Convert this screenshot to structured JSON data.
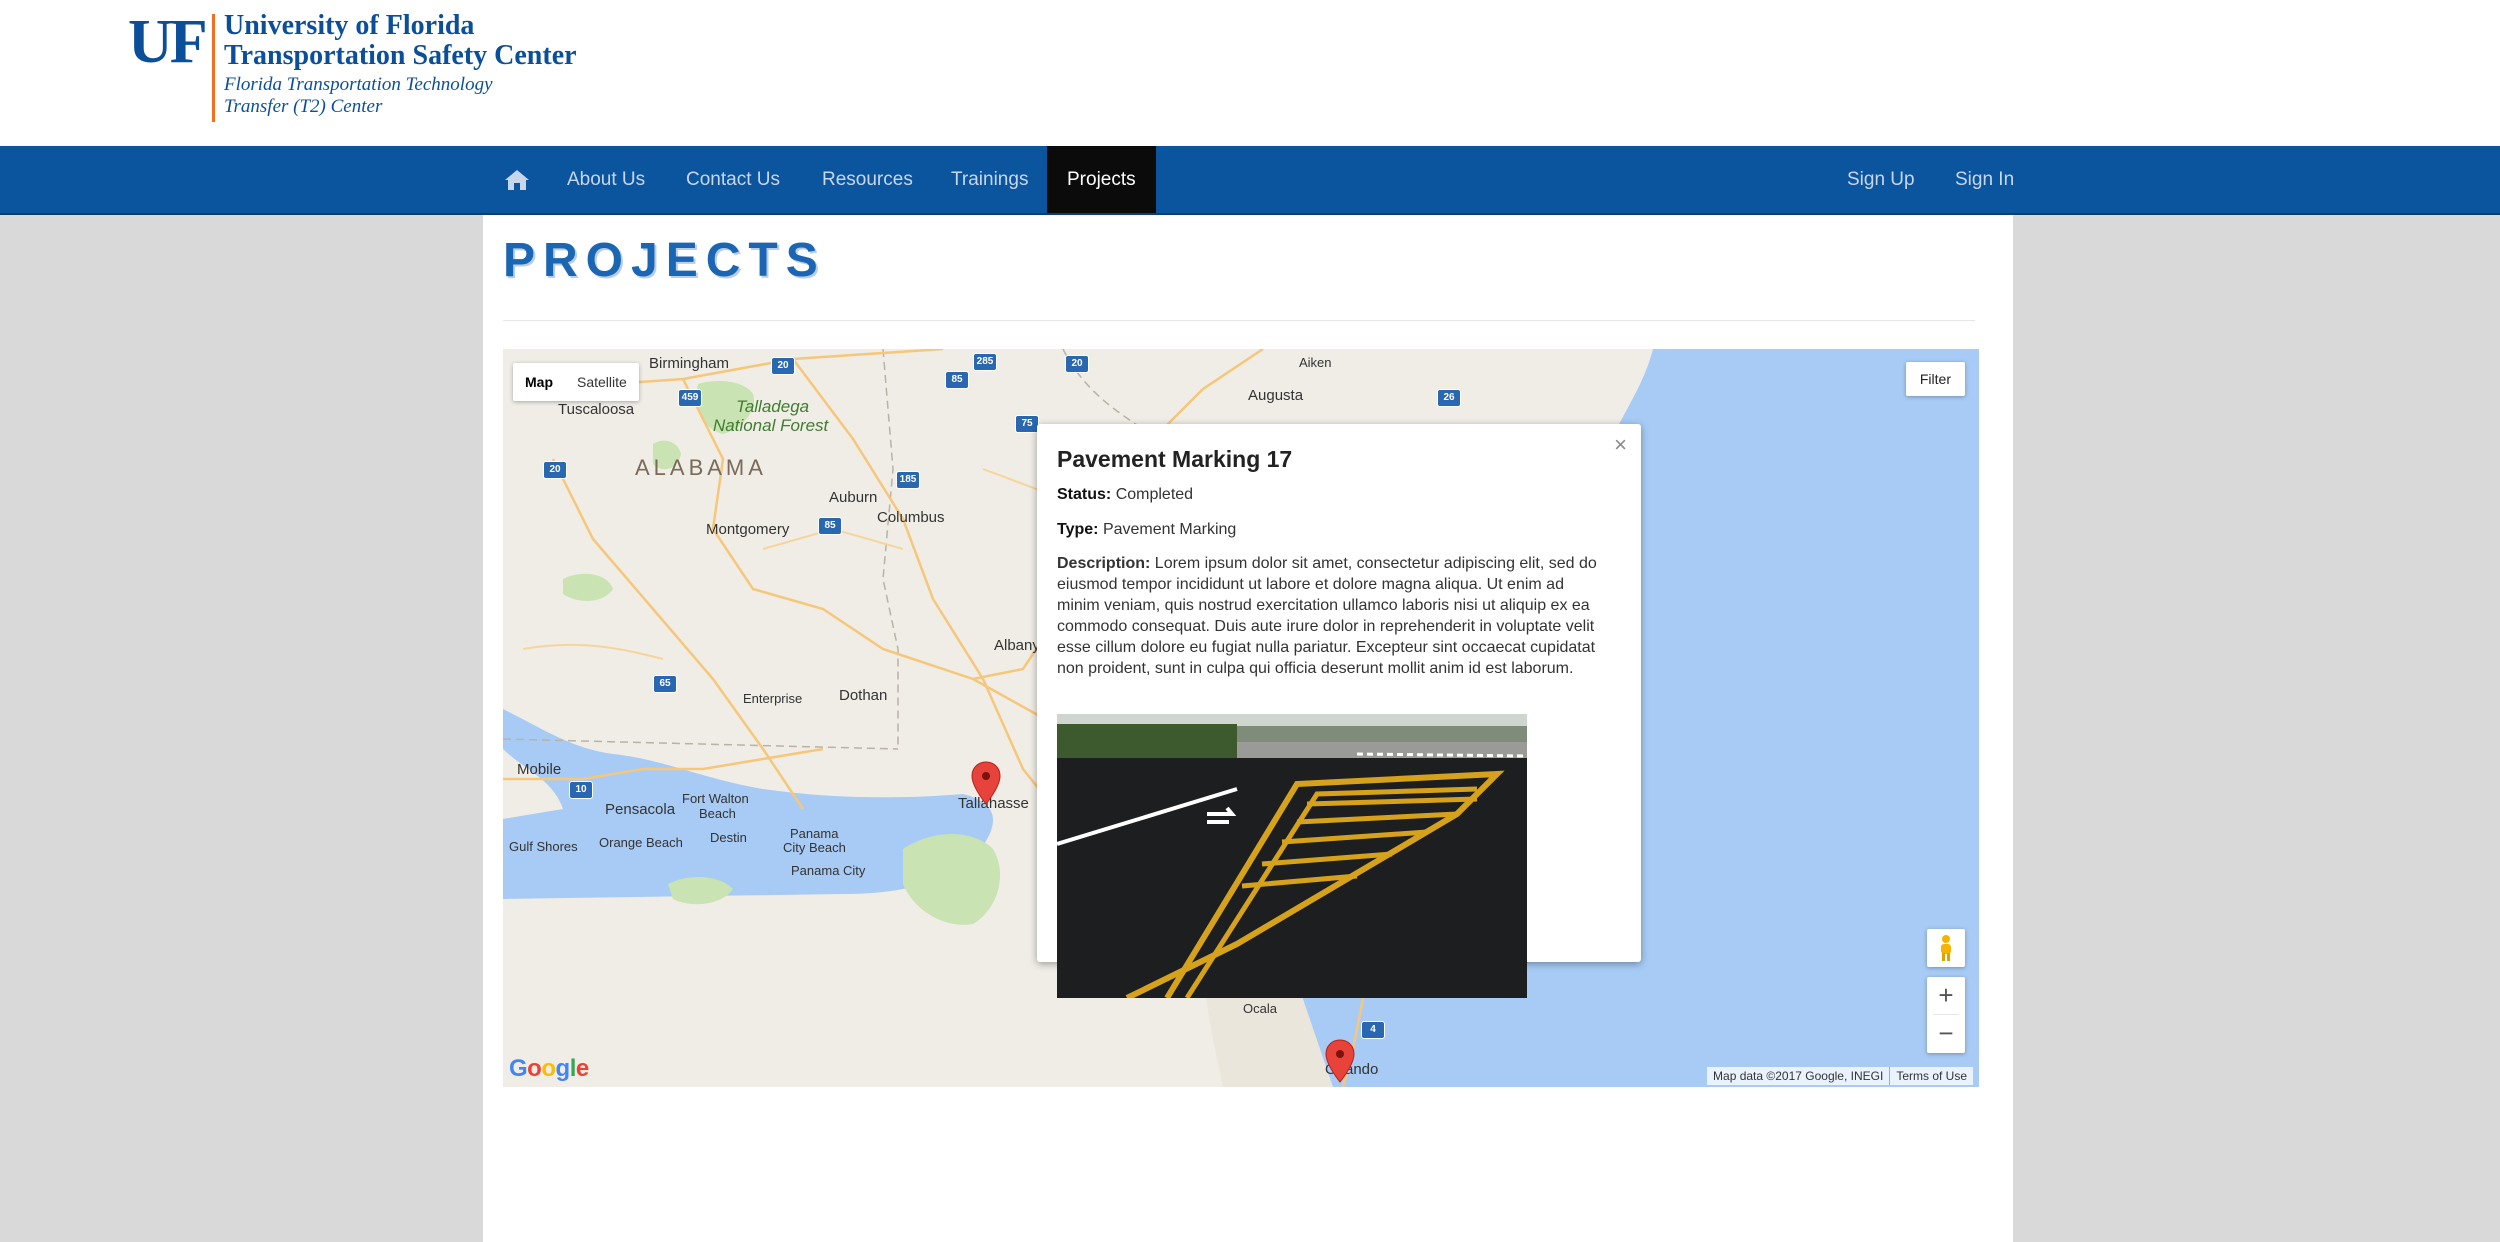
{
  "header": {
    "logo_mark": "UF",
    "logo_line1": "University of Florida",
    "logo_line2": "Transportation Safety Center",
    "logo_line3": "Florida Transportation Technology",
    "logo_line4": "Transfer (T2) Center"
  },
  "nav": {
    "items": [
      {
        "label": "About Us"
      },
      {
        "label": "Contact Us"
      },
      {
        "label": "Resources"
      },
      {
        "label": "Trainings"
      },
      {
        "label": "Projects"
      }
    ],
    "active": "Projects",
    "right": [
      {
        "label": "Sign Up"
      },
      {
        "label": "Sign In"
      }
    ]
  },
  "page": {
    "title": "PROJECTS"
  },
  "map": {
    "type_buttons": [
      "Map",
      "Satellite"
    ],
    "selected_type": "Map",
    "filter_label": "Filter",
    "zoom_in": "+",
    "zoom_out": "−",
    "google_logo": "Google",
    "attribution": "Map data ©2017 Google, INEGI",
    "terms": "Terms of Use",
    "labels": {
      "birmingham": "Birmingham",
      "tuscaloosa": "Tuscaloosa",
      "talladega": "Talladega",
      "national_forest": "National Forest",
      "alabama": "ALABAMA",
      "montgomery": "Montgomery",
      "auburn": "Auburn",
      "columbus": "Columbus",
      "augusta": "Augusta",
      "aiken": "Aiken",
      "albany": "Albany",
      "enterprise": "Enterprise",
      "dothan": "Dothan",
      "mobile": "Mobile",
      "pensacola": "Pensacola",
      "fort_walton": "Fort Walton",
      "beach": "Beach",
      "destin": "Destin",
      "panama": "Panama",
      "city_beach": "City Beach",
      "panama_city": "Panama City",
      "gulf_shores": "Gulf Shores",
      "orange_beach": "Orange Beach",
      "tallahassee": "Tallahasse",
      "ocala": "Ocala",
      "orlando": "Orlando"
    },
    "shields": [
      "459",
      "20",
      "85",
      "285",
      "20",
      "26",
      "75",
      "20",
      "185",
      "85",
      "65",
      "10",
      "4"
    ]
  },
  "infowindow": {
    "title": "Pavement Marking 17",
    "status_label": "Status:",
    "status_value": "Completed",
    "type_label": "Type:",
    "type_value": "Pavement Marking",
    "description_label": "Description:",
    "description_value": "Lorem ipsum dolor sit amet, consectetur adipiscing elit, sed do eiusmod tempor incididunt ut labore et dolore magna aliqua. Ut enim ad minim veniam, quis nostrud exercitation ullamco laboris nisi ut aliquip ex ea commodo consequat. Duis aute irure dolor in reprehenderit in voluptate velit esse cillum dolore eu fugiat nulla pariatur. Excepteur sint occaecat cupidatat non proident, sunt in culpa qui officia deserunt mollit anim id est laborum.",
    "close": "×"
  },
  "colors": {
    "brand_blue": "#0b559f",
    "nav_active": "#0b0b0b",
    "title_blue": "#1a66b3",
    "uf_orange": "#f37021",
    "marker_red": "#e8433a"
  }
}
